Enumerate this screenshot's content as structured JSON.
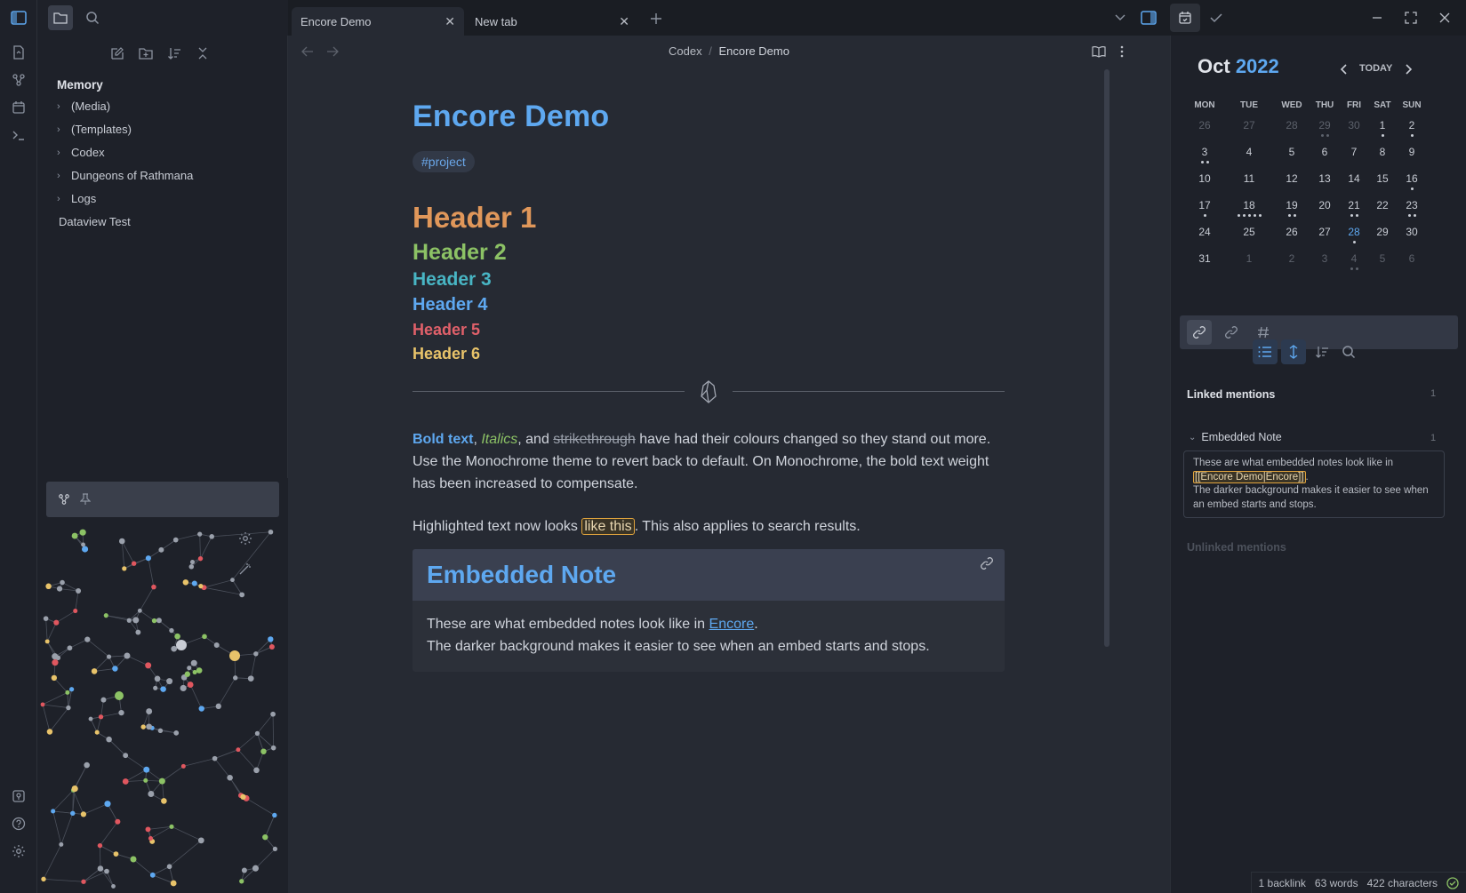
{
  "tabs": [
    {
      "label": "Encore Demo",
      "active": true
    },
    {
      "label": "New tab",
      "active": false
    }
  ],
  "breadcrumb": {
    "parent": "Codex",
    "separator": "/",
    "current": "Encore Demo"
  },
  "file_tree": {
    "root": "Memory",
    "items": [
      {
        "label": "(Media)",
        "folder": true
      },
      {
        "label": "(Templates)",
        "folder": true
      },
      {
        "label": "Codex",
        "folder": true
      },
      {
        "label": "Dungeons of Rathmana",
        "folder": true
      },
      {
        "label": "Logs",
        "folder": true
      },
      {
        "label": "Dataview Test",
        "folder": false
      }
    ]
  },
  "note": {
    "title": "Encore Demo",
    "tag": "#project",
    "headers": [
      {
        "text": "Header 1",
        "color": "#e0975a"
      },
      {
        "text": "Header 2",
        "color": "#8cc265"
      },
      {
        "text": "Header 3",
        "color": "#48b5c4"
      },
      {
        "text": "Header 4",
        "color": "#5ea8f0"
      },
      {
        "text": "Header 5",
        "color": "#e0606a"
      },
      {
        "text": "Header 6",
        "color": "#e8c36a"
      }
    ],
    "para1": {
      "bold": "Bold text",
      "comma1": ", ",
      "italics": "Italics",
      "and": ", and ",
      "strike": "strikethrough",
      "rest": " have had their colours changed so they stand out more. Use the Monochrome theme to revert back to default. On Monochrome, the bold text weight has been increased to compensate."
    },
    "para2": {
      "before": "Highlighted text now looks ",
      "highlight": "like this",
      "after": ". This also applies to search results."
    },
    "embed": {
      "title": "Embedded Note",
      "line1_before": "These are what embedded notes look like in ",
      "line1_link": "Encore",
      "line1_after": ".",
      "line2": "The darker background makes it easier to see when an embed starts and stops."
    }
  },
  "calendar": {
    "month": "Oct",
    "year": "2022",
    "today_label": "TODAY",
    "weekdays": [
      "MON",
      "TUE",
      "WED",
      "THU",
      "FRI",
      "SAT",
      "SUN"
    ],
    "weeks": [
      [
        {
          "d": "26",
          "f": true
        },
        {
          "d": "27",
          "f": true
        },
        {
          "d": "28",
          "f": true
        },
        {
          "d": "29",
          "f": true,
          "dots": 2
        },
        {
          "d": "30",
          "f": true
        },
        {
          "d": "1",
          "dots": 1
        },
        {
          "d": "2",
          "dots": 1
        }
      ],
      [
        {
          "d": "3",
          "dots": 2
        },
        {
          "d": "4"
        },
        {
          "d": "5"
        },
        {
          "d": "6"
        },
        {
          "d": "7"
        },
        {
          "d": "8"
        },
        {
          "d": "9"
        }
      ],
      [
        {
          "d": "10"
        },
        {
          "d": "11"
        },
        {
          "d": "12"
        },
        {
          "d": "13"
        },
        {
          "d": "14"
        },
        {
          "d": "15"
        },
        {
          "d": "16",
          "dots": 1
        }
      ],
      [
        {
          "d": "17",
          "dots": 1
        },
        {
          "d": "18",
          "dots": 5
        },
        {
          "d": "19",
          "dots": 2
        },
        {
          "d": "20"
        },
        {
          "d": "21",
          "dots": 2
        },
        {
          "d": "22"
        },
        {
          "d": "23",
          "dots": 2
        }
      ],
      [
        {
          "d": "24"
        },
        {
          "d": "25"
        },
        {
          "d": "26"
        },
        {
          "d": "27"
        },
        {
          "d": "28",
          "today": true,
          "dots": 1
        },
        {
          "d": "29"
        },
        {
          "d": "30"
        }
      ],
      [
        {
          "d": "31"
        },
        {
          "d": "1",
          "f": true
        },
        {
          "d": "2",
          "f": true
        },
        {
          "d": "3",
          "f": true
        },
        {
          "d": "4",
          "f": true,
          "dots": 2
        },
        {
          "d": "5",
          "f": true
        },
        {
          "d": "6",
          "f": true
        }
      ]
    ]
  },
  "backlinks": {
    "linked_label": "Linked mentions",
    "linked_count": "1",
    "file_label": "Embedded Note",
    "file_count": "1",
    "snippet_before": "These are what embedded notes look like in ",
    "snippet_highlight": "[[Encore Demo|Encore]]",
    "snippet_after": ".",
    "snippet_line2": "The darker background makes it easier to see when an embed starts and stops.",
    "unlinked_label": "Unlinked mentions"
  },
  "status": {
    "backlinks": "1 backlink",
    "words": "63 words",
    "chars": "422 characters"
  },
  "colors": {
    "accent": "#5ea8f0",
    "highlight": "#e0a43e",
    "bg_editor": "#262a33"
  }
}
